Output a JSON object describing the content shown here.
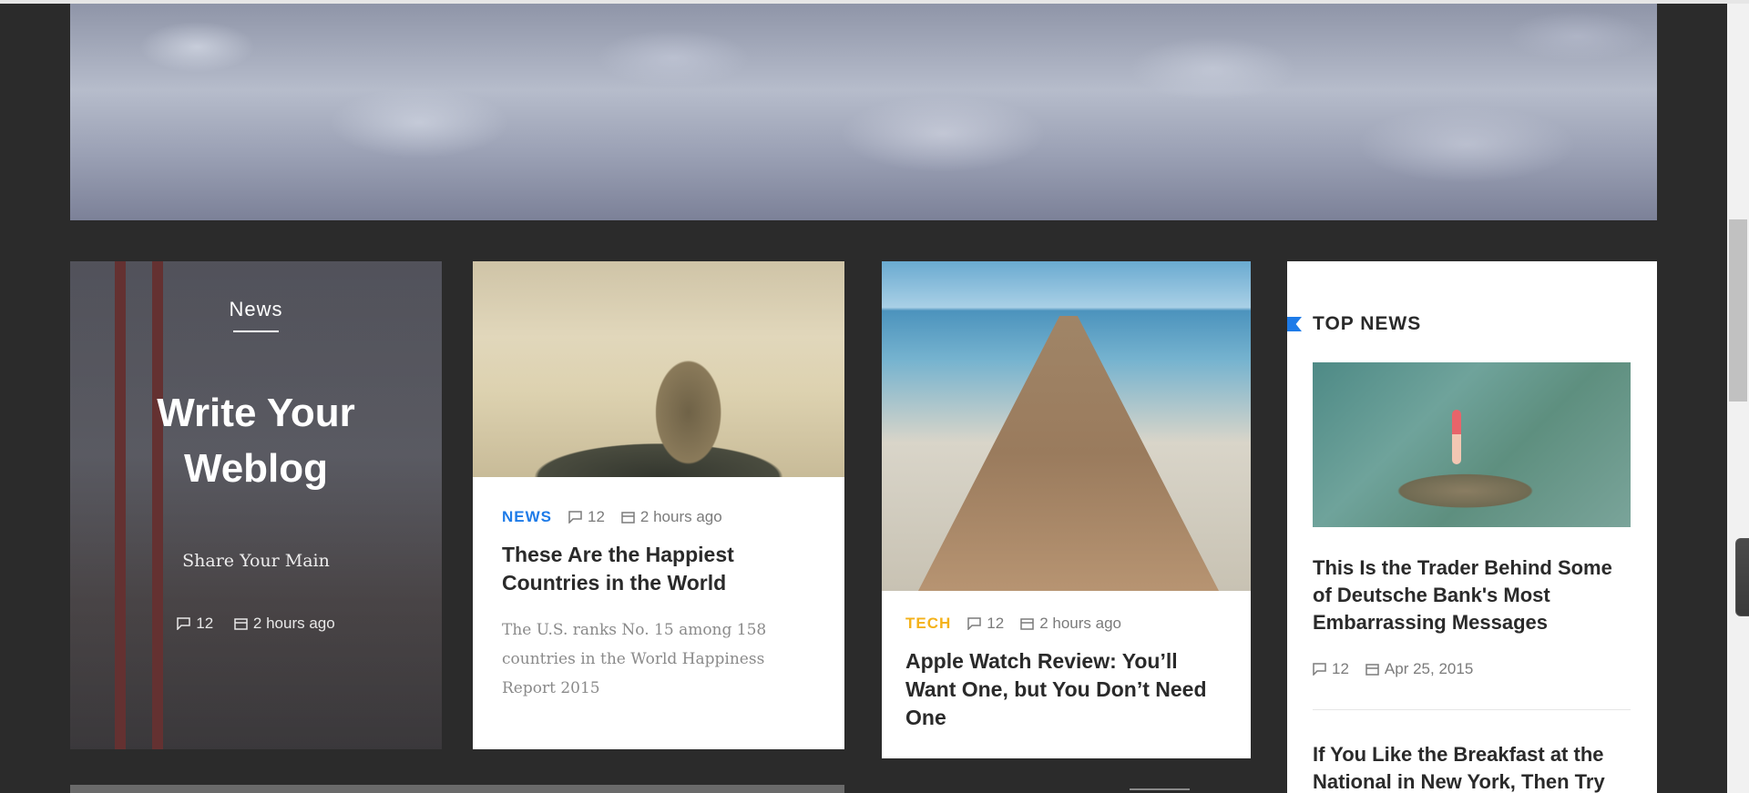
{
  "hero": {
    "alt_name": "clouds-banner"
  },
  "feature": {
    "category": "News",
    "title_line1": "Write Your",
    "title_line2": "Weblog",
    "subtitle": "Share Your Main",
    "comments": "12",
    "time": "2 hours ago"
  },
  "posts": [
    {
      "category": "NEWS",
      "comments": "12",
      "time": "2 hours ago",
      "title": "These Are the Happiest Countries in the World",
      "excerpt": "The U.S. ranks No. 15 among 158 countries in the World Happiness Report 2015"
    },
    {
      "category": "TECH",
      "comments": "12",
      "time": "2 hours ago",
      "title": "Apple Watch Review: You’ll Want One, but You Don’t Need One"
    }
  ],
  "top_news": {
    "heading": "TOP NEWS",
    "items": [
      {
        "title": "This Is the Trader Behind Some of Deutsche Bank's Most Embarrassing Messages",
        "comments": "12",
        "date": "Apr 25, 2015"
      },
      {
        "title": "If You Like the Breakfast at the National in New York, Then Try"
      }
    ]
  },
  "colors": {
    "news_accent": "#1e7be8",
    "tech_accent": "#f4b21a",
    "background": "#2b2b2b"
  },
  "icons": {
    "comment": "comment-icon",
    "calendar": "calendar-icon",
    "flag": "flag-icon"
  }
}
